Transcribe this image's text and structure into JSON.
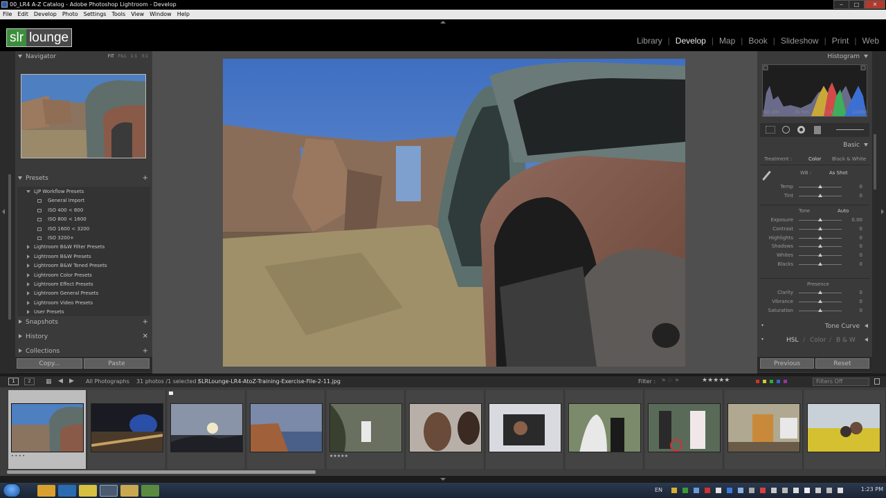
{
  "window": {
    "title": "00_LR4 A-Z Catalog - Adobe Photoshop Lightroom - Develop",
    "controls": [
      "minimize",
      "maximize",
      "close"
    ]
  },
  "menu": [
    "File",
    "Edit",
    "Develop",
    "Photo",
    "Settings",
    "Tools",
    "View",
    "Window",
    "Help"
  ],
  "brand": {
    "part1": "slr",
    "part2": "lounge"
  },
  "modules": {
    "items": [
      "Library",
      "Develop",
      "Map",
      "Book",
      "Slideshow",
      "Print",
      "Web"
    ],
    "active": "Develop"
  },
  "navigator": {
    "title": "Navigator",
    "options": [
      "FIT",
      "FILL",
      "1:1",
      "3:1"
    ],
    "selected_option": "FIT"
  },
  "presets": {
    "title": "Presets",
    "items": [
      {
        "label": "LJP Workflow Presets",
        "type": "folder-open"
      },
      {
        "label": "General Import",
        "type": "preset"
      },
      {
        "label": "ISO 400 < 800",
        "type": "preset"
      },
      {
        "label": "ISO 800 < 1600",
        "type": "preset"
      },
      {
        "label": "ISO 1600 < 3200",
        "type": "preset"
      },
      {
        "label": "ISO 3200+",
        "type": "preset"
      },
      {
        "label": "Lightroom B&W Filter Presets",
        "type": "folder"
      },
      {
        "label": "Lightroom B&W Presets",
        "type": "folder"
      },
      {
        "label": "Lightroom B&W Toned Presets",
        "type": "folder"
      },
      {
        "label": "Lightroom Color Presets",
        "type": "folder"
      },
      {
        "label": "Lightroom Effect Presets",
        "type": "folder"
      },
      {
        "label": "Lightroom General Presets",
        "type": "folder"
      },
      {
        "label": "Lightroom Video Presets",
        "type": "folder"
      },
      {
        "label": "User Presets",
        "type": "folder"
      }
    ]
  },
  "left_panels": {
    "snapshots": "Snapshots",
    "history": "History",
    "collections": "Collections"
  },
  "left_buttons": {
    "copy": "Copy...",
    "paste": "Paste"
  },
  "histogram": {
    "title": "Histogram",
    "iso": "ISO 200",
    "focal": "35 mm",
    "aperture": "f / 4.0",
    "shutter": "1/1600"
  },
  "basic": {
    "title": "Basic",
    "treatment_label": "Treatment :",
    "treatment_color": "Color",
    "treatment_bw": "Black & White",
    "wb_label": "WB :",
    "wb_value": "As Shot",
    "sliders_wb": [
      {
        "label": "Temp",
        "value": "0",
        "pos": 0.5
      },
      {
        "label": "Tint",
        "value": "0",
        "pos": 0.5
      }
    ],
    "tone_label": "Tone",
    "tone_auto": "Auto",
    "sliders_tone": [
      {
        "label": "Exposure",
        "value": "0.00",
        "pos": 0.5
      },
      {
        "label": "Contrast",
        "value": "0",
        "pos": 0.5
      },
      {
        "label": "Highlights",
        "value": "0",
        "pos": 0.5
      },
      {
        "label": "Shadows",
        "value": "0",
        "pos": 0.5
      },
      {
        "label": "Whites",
        "value": "0",
        "pos": 0.5
      },
      {
        "label": "Blacks",
        "value": "0",
        "pos": 0.5
      }
    ],
    "presence_label": "Presence",
    "sliders_presence": [
      {
        "label": "Clarity",
        "value": "0",
        "pos": 0.5
      },
      {
        "label": "Vibrance",
        "value": "0",
        "pos": 0.5
      },
      {
        "label": "Saturation",
        "value": "0",
        "pos": 0.5
      }
    ]
  },
  "right_panels": {
    "tone_curve": "Tone Curve",
    "hsl": "HSL",
    "color": "Color",
    "bw": "B & W"
  },
  "right_buttons": {
    "previous": "Previous",
    "reset": "Reset"
  },
  "filmstrip": {
    "source": "All Photographs",
    "count": "31 photos /1 selected /",
    "filename": "SLRLounge-LR4-AtoZ-Training-Exercise-File-2-11.jpg",
    "filter_label": "Filter :",
    "filter_value": "Filters Off",
    "page1": "1",
    "page2": "2"
  },
  "taskbar": {
    "lang": "EN",
    "time": "1:23 PM"
  },
  "colors": {
    "brand_green": "#3b8f3b",
    "panel_bg": "#3a3a3a",
    "center_bg": "#4f4f4f"
  }
}
